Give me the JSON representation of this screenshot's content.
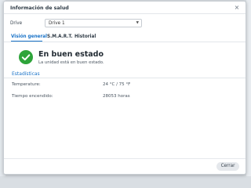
{
  "dialog": {
    "title": "Información de salud",
    "close_icon": "×"
  },
  "drive": {
    "label": "Drive",
    "selected": "Drive 1"
  },
  "tabs": [
    {
      "label": "Visión general",
      "active": true
    },
    {
      "label": "S.M.A.R.T.",
      "active": false
    },
    {
      "label": "Historial",
      "active": false
    }
  ],
  "status": {
    "icon": "check-circle-icon",
    "color": "#2ea43a",
    "title": "En buen estado",
    "subtitle": "La unidad está en buen estado."
  },
  "stats_link": "Estadísticas",
  "details": [
    {
      "label": "Temperature:",
      "value": "24 °C / 75 °F"
    },
    {
      "label": "Tiempo encendido:",
      "value": "28053 horas"
    }
  ],
  "footer": {
    "close_label": "Cerrar"
  },
  "colors": {
    "accent": "#1a73c8",
    "success": "#2ea43a"
  }
}
